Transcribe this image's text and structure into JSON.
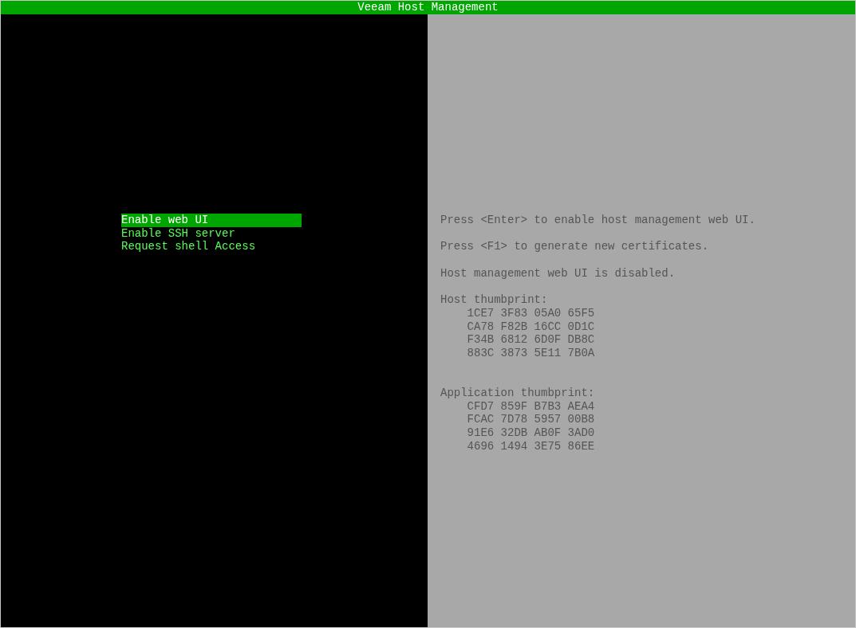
{
  "title_bar": {
    "title": "Veeam Host Management"
  },
  "menu": [
    {
      "label": "Enable web UI",
      "selected": true
    },
    {
      "label": "Enable SSH server",
      "selected": false
    },
    {
      "label": "Request shell Access",
      "selected": false
    }
  ],
  "messages": [
    "Press <Enter> to enable host management web UI.",
    "Press <F1> to generate new certificates.",
    "Host management web UI is disabled."
  ],
  "thumbprints": [
    {
      "title": "Host thumbprint:",
      "lines": [
        "1CE7 3F83 05A0 65F5",
        "CA78 F82B 16CC 0D1C",
        "F34B 6812 6D0F DB8C",
        "883C 3873 5E11 7B0A"
      ]
    },
    {
      "title": "Application thumbprint:",
      "lines": [
        "CFD7 859F B7B3 AEA4",
        "FCAC 7D78 5957 00B8",
        "91E6 32DB AB0F 3AD0",
        "4696 1494 3E75 86EE"
      ]
    }
  ]
}
